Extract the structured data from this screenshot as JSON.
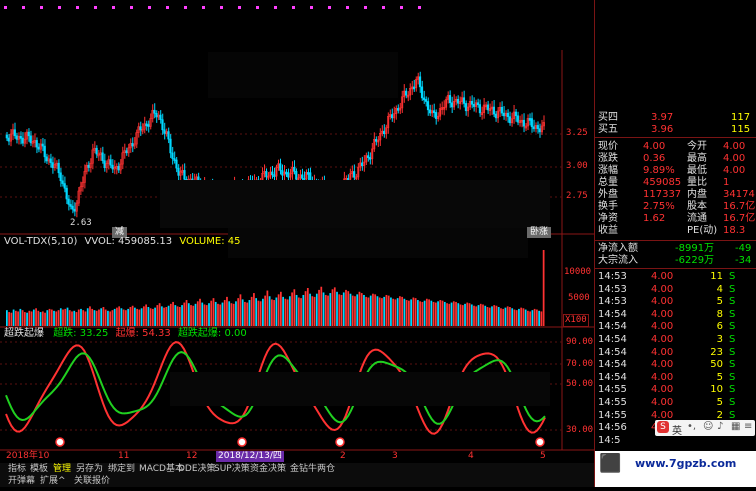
{
  "main_chart": {
    "price_labels": [
      "3.25",
      "3.00",
      "2.75"
    ],
    "low_marker": "2.63",
    "flags": [
      "减",
      "减",
      "卧涨"
    ]
  },
  "volume_panel": {
    "header": "VOL-TDX(5,10)",
    "vvol_label": "VVOL: 459085.13",
    "volume_label": "VOLUME: 45",
    "axis": [
      "10000",
      "5000"
    ],
    "unit": "X100",
    "values": [
      2500,
      2200,
      2100,
      2600,
      2400,
      2300,
      2700,
      2500,
      2200,
      2100,
      2400,
      2300,
      2600,
      2800,
      2400,
      2200,
      2300,
      2100,
      2500,
      2700,
      2600,
      2400,
      2300,
      2500,
      2800,
      2600,
      2700,
      2900,
      2500,
      2300,
      2400,
      2200,
      2600,
      2700,
      2500,
      2300,
      2800,
      3100,
      2700,
      2500,
      2400,
      2600,
      2800,
      3000,
      2600,
      2400,
      2300,
      2500,
      2700,
      2900,
      3100,
      2800,
      2600,
      2500,
      2700,
      3000,
      3200,
      2900,
      2700,
      2600,
      2800,
      3100,
      3400,
      3000,
      2800,
      2700,
      2900,
      3300,
      3600,
      3100,
      2900,
      3000,
      3200,
      3500,
      3800,
      3300,
      3100,
      3000,
      3300,
      3700,
      4100,
      3600,
      3300,
      3200,
      3500,
      3900,
      4300,
      3700,
      3400,
      3300,
      3600,
      4000,
      4400,
      3800,
      3500,
      3400,
      3700,
      4100,
      4600,
      3900,
      3600,
      3500,
      3900,
      4400,
      5000,
      4200,
      3800,
      3700,
      4100,
      4600,
      5200,
      4400,
      4000,
      3900,
      4300,
      4800,
      5600,
      4700,
      4200,
      4100,
      4500,
      5000,
      5400,
      4600,
      4300,
      4200,
      4700,
      5300,
      5800,
      4900,
      4500,
      4400,
      4900,
      5500,
      6000,
      5100,
      4700,
      4600,
      5100,
      5700,
      6200,
      5300,
      4900,
      4800,
      5200,
      5800,
      6100,
      5400,
      5000,
      4900,
      5300,
      5700,
      5500,
      5100,
      4800,
      4700,
      5000,
      5400,
      5200,
      4900,
      4600,
      4500,
      4800,
      5100,
      5000,
      4700,
      4500,
      4400,
      4600,
      4900,
      4800,
      4500,
      4300,
      4200,
      4400,
      4700,
      4600,
      4300,
      4100,
      4000,
      4200,
      4500,
      4400,
      4100,
      3900,
      3800,
      4000,
      4300,
      4200,
      4000,
      3800,
      3700,
      3900,
      4100,
      4000,
      3800,
      3600,
      3500,
      3700,
      3900,
      3800,
      3600,
      3400,
      3300,
      3500,
      3700,
      3600,
      3400,
      3200,
      3100,
      3300,
      3500,
      3400,
      3200,
      3000,
      2900,
      3100,
      3300,
      3200,
      3000,
      2800,
      2700,
      2900,
      3100,
      3000,
      2800,
      2600,
      2500,
      2700,
      2900,
      2800,
      2600,
      2400,
      2300,
      2500,
      2700,
      2600,
      2400,
      2300,
      12000
    ]
  },
  "oscillator": {
    "title": "超跌起爆",
    "lines": [
      {
        "label": "超跌: 33.25",
        "color": "#00e000"
      },
      {
        "label": "起爆: 54.33",
        "color": "#ff3232"
      },
      {
        "label": "超跌起爆: 0.00",
        "color": "#00e000"
      }
    ],
    "axis": [
      "90.00",
      "70.00",
      "50.00",
      "30.00"
    ]
  },
  "time_axis": {
    "labels": [
      "2018年10",
      "11",
      "12",
      "2018/12/13/四",
      "2",
      "3",
      "4",
      "5"
    ]
  },
  "tabs_row1": [
    "指标",
    "模板",
    "管理",
    "另存为",
    "绑定到",
    "MACD基本",
    "DDE决策",
    "SUP决策",
    "资金决策",
    "金钻牛两仓"
  ],
  "active_tab": "管理",
  "tabs_row2": [
    "开弹幕",
    "扩展^",
    "关联报价"
  ],
  "quote": {
    "order_book": [
      {
        "label": "买四",
        "price": "3.97",
        "vol": "117"
      },
      {
        "label": "买五",
        "price": "3.96",
        "vol": "115"
      }
    ],
    "rows": [
      {
        "l1": "现价",
        "v1": "4.00",
        "l2": "今开",
        "v2": "4.00"
      },
      {
        "l1": "涨跌",
        "v1": "0.36",
        "l2": "最高",
        "v2": "4.00"
      },
      {
        "l1": "涨幅",
        "v1": "9.89%",
        "l2": "最低",
        "v2": "4.00"
      },
      {
        "l1": "总量",
        "v1": "459085",
        "l2": "量比",
        "v2": "1"
      },
      {
        "l1": "外盘",
        "v1": "117337",
        "l2": "内盘",
        "v2": "34174"
      },
      {
        "l1": "换手",
        "v1": "2.75%",
        "l2": "股本",
        "v2": "16.7亿"
      },
      {
        "l1": "净资",
        "v1": "1.62",
        "l2": "流通",
        "v2": "16.7亿"
      },
      {
        "l1": "收益",
        "v1": "",
        "l2": "PE(动)",
        "v2": "18.3"
      }
    ],
    "flows": [
      {
        "label": "净流入额",
        "value": "-8991万",
        "extra": "-49"
      },
      {
        "label": "大宗流入",
        "value": "-6229万",
        "extra": "-34"
      }
    ],
    "ticks": [
      {
        "time": "14:53",
        "price": "4.00",
        "vol": "11",
        "side": "S"
      },
      {
        "time": "14:53",
        "price": "4.00",
        "vol": "4",
        "side": "S"
      },
      {
        "time": "14:53",
        "price": "4.00",
        "vol": "5",
        "side": "S"
      },
      {
        "time": "14:54",
        "price": "4.00",
        "vol": "8",
        "side": "S"
      },
      {
        "time": "14:54",
        "price": "4.00",
        "vol": "6",
        "side": "S"
      },
      {
        "time": "14:54",
        "price": "4.00",
        "vol": "3",
        "side": "S"
      },
      {
        "time": "14:54",
        "price": "4.00",
        "vol": "23",
        "side": "S"
      },
      {
        "time": "14:54",
        "price": "4.00",
        "vol": "50",
        "side": "S"
      },
      {
        "time": "14:54",
        "price": "4.00",
        "vol": "5",
        "side": "S"
      },
      {
        "time": "14:55",
        "price": "4.00",
        "vol": "10",
        "side": "S"
      },
      {
        "time": "14:55",
        "price": "4.00",
        "vol": "5",
        "side": "S"
      },
      {
        "time": "14:55",
        "price": "4.00",
        "vol": "2",
        "side": "S"
      },
      {
        "time": "14:56",
        "price": "4.00",
        "vol": "1",
        "side": "S"
      },
      {
        "time": "14:5",
        "price": "",
        "vol": "",
        "side": ""
      }
    ],
    "watermark": "www.7gpzb.com",
    "ime_label": "英"
  }
}
